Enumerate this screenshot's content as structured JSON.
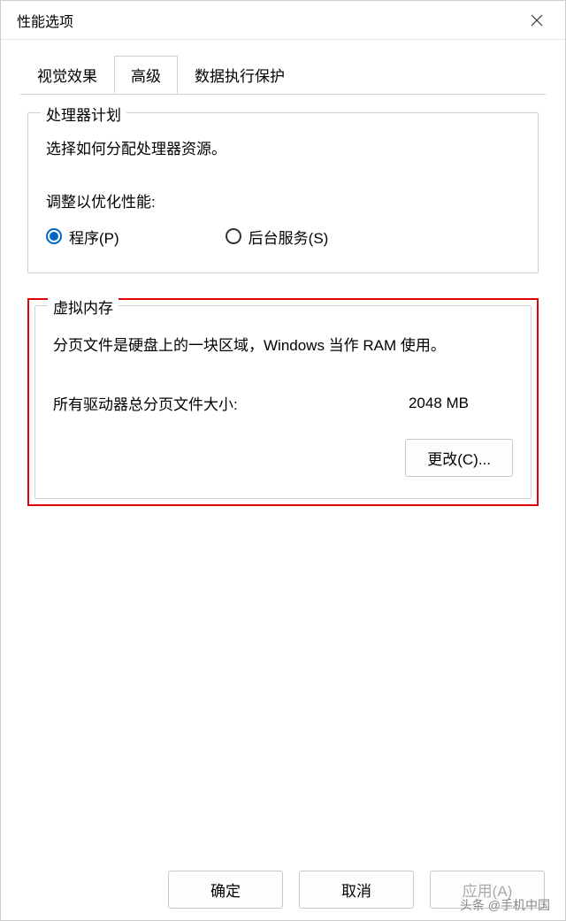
{
  "window": {
    "title": "性能选项"
  },
  "tabs": {
    "visual": "视觉效果",
    "advanced": "高级",
    "dep": "数据执行保护"
  },
  "processor": {
    "group_title": "处理器计划",
    "description": "选择如何分配处理器资源。",
    "adjust_label": "调整以优化性能:",
    "option_programs": "程序(P)",
    "option_services": "后台服务(S)"
  },
  "virtual_memory": {
    "group_title": "虚拟内存",
    "description": "分页文件是硬盘上的一块区域，Windows 当作 RAM 使用。",
    "total_label": "所有驱动器总分页文件大小:",
    "total_value": "2048 MB",
    "change_button": "更改(C)..."
  },
  "buttons": {
    "ok": "确定",
    "cancel": "取消",
    "apply": "应用(A)"
  },
  "watermark": "头条 @手机中国"
}
